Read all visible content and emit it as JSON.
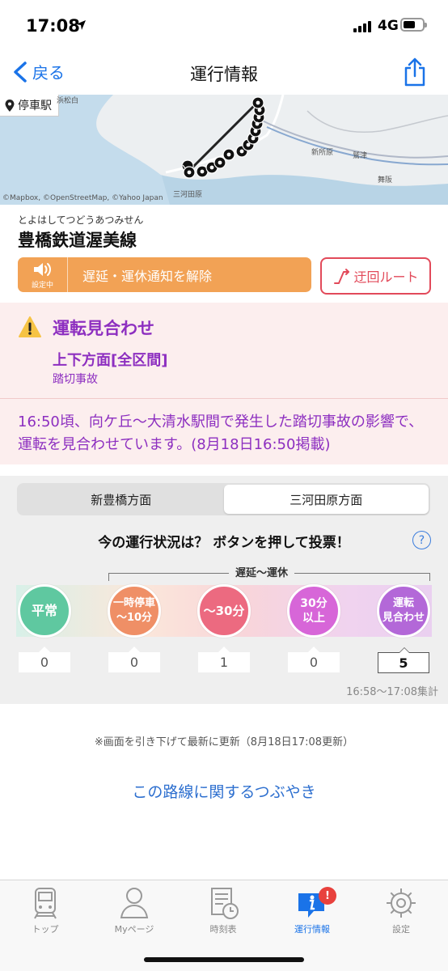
{
  "status_bar": {
    "time": "17:08",
    "network": "4G"
  },
  "nav": {
    "back_label": "戻る",
    "title": "運行情報"
  },
  "map": {
    "stop_badge": "停車駅",
    "attribution": "©Mapbox, ©OpenStreetMap, ©Yahoo Japan",
    "places": [
      "新所原",
      "鷲津",
      "舞阪",
      "三河田原",
      "浜松白"
    ]
  },
  "line": {
    "ruby": "とよはしてつどうあつみせん",
    "name": "豊橋鉄道渥美線",
    "alert_button_label": "遅延・運休通知を解除",
    "alert_button_sub": "設定中",
    "detour_label": "迂回ルート"
  },
  "alert": {
    "status": "運転見合わせ",
    "direction": "上下方面[全区間]",
    "cause": "踏切事故",
    "detail": "16:50頃、向ケ丘～大清水駅間で発生した踏切事故の影響で、運転を見合わせています。(8月18日16:50掲載)"
  },
  "vote": {
    "tabs": [
      {
        "label": "新豊橋方面",
        "active": false
      },
      {
        "label": "三河田原方面",
        "active": true
      }
    ],
    "question": "今の運行状況は？ ボタンを押して投票！",
    "help": "?",
    "range_label": "遅延～運休",
    "options": [
      {
        "label": "平常",
        "count": "0",
        "color": "#5fc8a0"
      },
      {
        "label": "一時停車\n～10分",
        "count": "0",
        "color": "#ef8f66"
      },
      {
        "label": "～30分",
        "count": "1",
        "color": "#ec6a80"
      },
      {
        "label": "30分\n以上",
        "count": "0",
        "color": "#d766d8"
      },
      {
        "label": "運転\n見合わせ",
        "count": "5",
        "color": "#b368d8"
      }
    ],
    "period": "16:58～17:08集計"
  },
  "footer": {
    "note": "※画面を引き下げて最新に更新（8月18日17:08更新）",
    "tweets_link": "この路線に関するつぶやき"
  },
  "tabbar": {
    "items": [
      {
        "label": "トップ",
        "icon": "train-icon",
        "active": false
      },
      {
        "label": "Myページ",
        "icon": "person-icon",
        "active": false
      },
      {
        "label": "時刻表",
        "icon": "timetable-icon",
        "active": false
      },
      {
        "label": "運行情報",
        "icon": "info-icon",
        "active": true
      },
      {
        "label": "設定",
        "icon": "gear-icon",
        "active": false
      }
    ],
    "badge": "!"
  }
}
